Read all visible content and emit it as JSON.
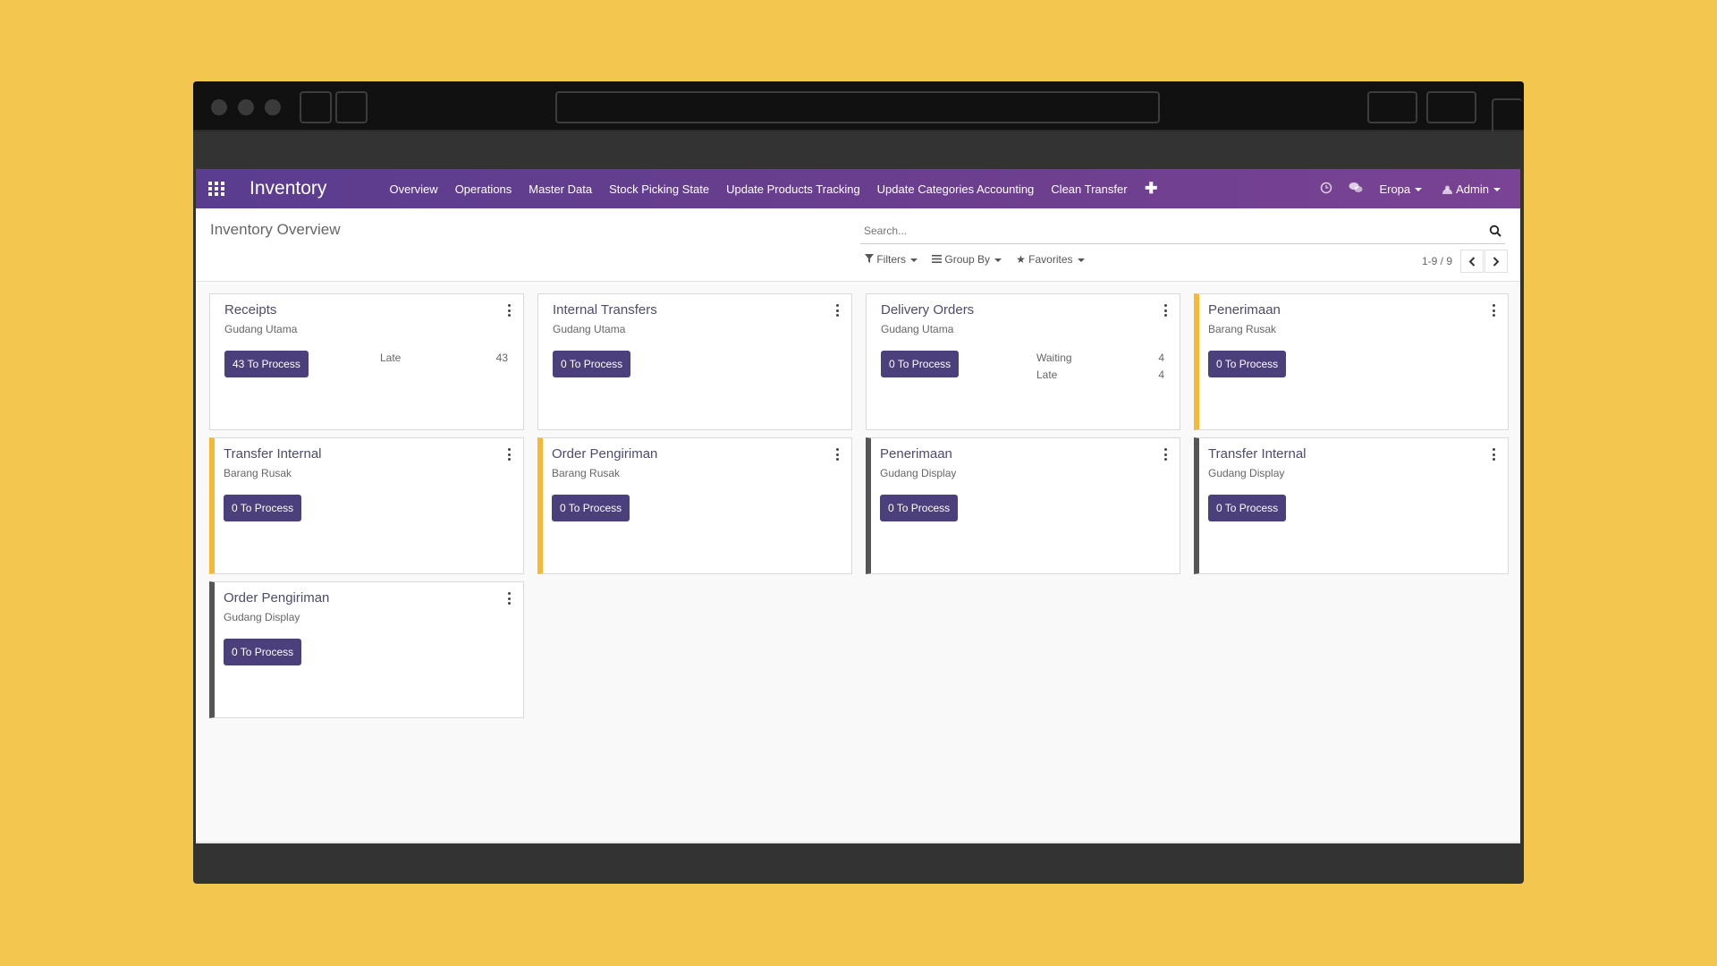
{
  "navbar": {
    "app_name": "Inventory",
    "menu": [
      "Overview",
      "Operations",
      "Master Data",
      "Stock Picking State",
      "Update Products Tracking",
      "Update Categories Accounting",
      "Clean Transfer"
    ],
    "plus_label": "✚",
    "company": "Eropa",
    "user": "Admin"
  },
  "control": {
    "breadcrumb": "Inventory Overview",
    "search_placeholder": "Search...",
    "filters_label": "Filters",
    "groupby_label": "Group By",
    "favorites_label": "Favorites",
    "pager_value": "1-9 / 9"
  },
  "cards": [
    {
      "title": "Receipts",
      "warehouse": "Gudang Utama",
      "button": "43 To Process",
      "accent": "none",
      "stats": [
        {
          "label": "Late",
          "value": "43"
        }
      ]
    },
    {
      "title": "Internal Transfers",
      "warehouse": "Gudang Utama",
      "button": "0 To Process",
      "accent": "none",
      "stats": []
    },
    {
      "title": "Delivery Orders",
      "warehouse": "Gudang Utama",
      "button": "0 To Process",
      "accent": "none",
      "stats": [
        {
          "label": "Waiting",
          "value": "4"
        },
        {
          "label": "Late",
          "value": "4"
        }
      ]
    },
    {
      "title": "Penerimaan",
      "warehouse": "Barang Rusak",
      "button": "0 To Process",
      "accent": "yellow",
      "stats": []
    },
    {
      "title": "Transfer Internal",
      "warehouse": "Barang Rusak",
      "button": "0 To Process",
      "accent": "yellow",
      "stats": []
    },
    {
      "title": "Order Pengiriman",
      "warehouse": "Barang Rusak",
      "button": "0 To Process",
      "accent": "yellow",
      "stats": []
    },
    {
      "title": "Penerimaan",
      "warehouse": "Gudang Display",
      "button": "0 To Process",
      "accent": "gray",
      "stats": []
    },
    {
      "title": "Transfer Internal",
      "warehouse": "Gudang Display",
      "button": "0 To Process",
      "accent": "gray",
      "stats": []
    },
    {
      "title": "Order Pengiriman",
      "warehouse": "Gudang Display",
      "button": "0 To Process",
      "accent": "gray",
      "stats": []
    }
  ],
  "colors": {
    "navbar_start": "#5A3D8F",
    "navbar_end": "#7A4393",
    "button": "#4B3F7C",
    "accent_yellow": "#F5B935",
    "accent_gray": "#555555",
    "background": "#F3C74F"
  },
  "icons": {
    "apps": "apps-grid-icon",
    "activity": "clock-icon",
    "messages": "chat-icon",
    "search": "search-icon",
    "filter": "filter-icon",
    "groupby": "list-icon",
    "favorites": "star-icon",
    "company": "caret-down-icon",
    "user_avatar": "avatar-icon",
    "card_menu": "kebab-menu-icon",
    "pager_prev": "chevron-left-icon",
    "pager_next": "chevron-right-icon"
  }
}
